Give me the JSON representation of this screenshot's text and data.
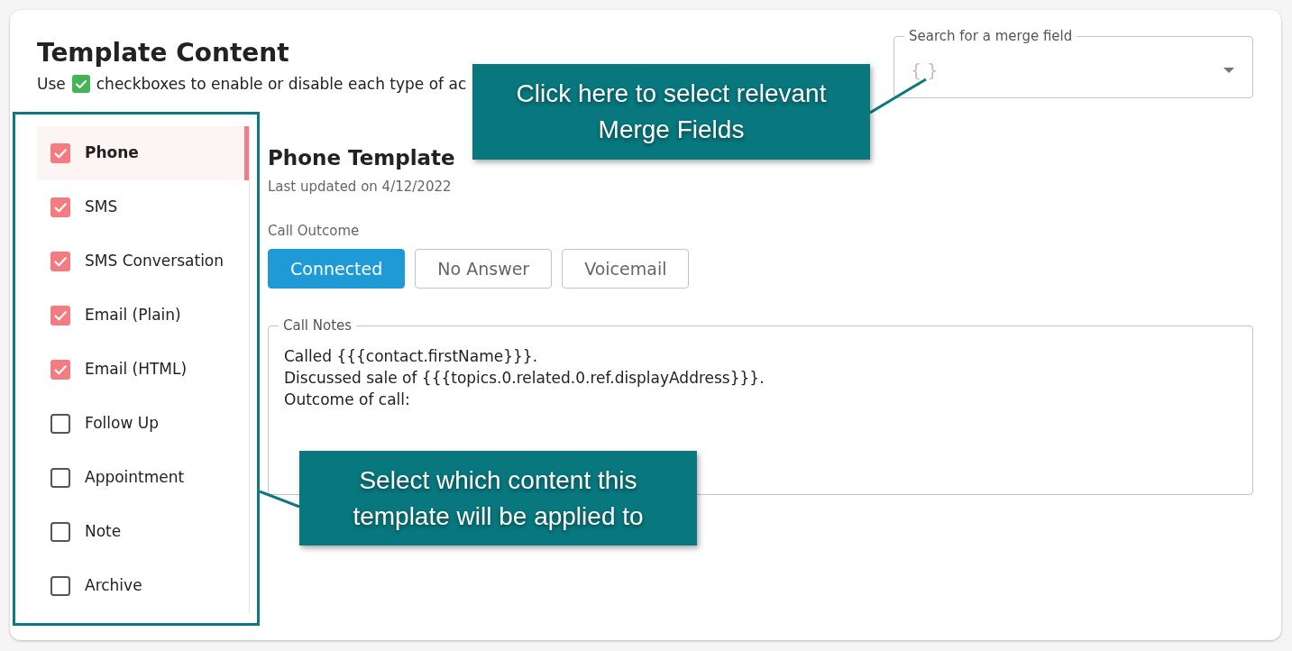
{
  "header": {
    "title": "Template Content",
    "subtitle_before_icon": "Use",
    "subtitle_after_icon": "checkboxes to enable or disable each type of ac"
  },
  "merge_field_search": {
    "label": "Search for a merge field",
    "prefix": "{ }"
  },
  "content_types": [
    {
      "label": "Phone",
      "checked": true,
      "selected": true
    },
    {
      "label": "SMS",
      "checked": true,
      "selected": false
    },
    {
      "label": "SMS Conversation",
      "checked": true,
      "selected": false
    },
    {
      "label": "Email (Plain)",
      "checked": true,
      "selected": false
    },
    {
      "label": "Email (HTML)",
      "checked": true,
      "selected": false
    },
    {
      "label": "Follow Up",
      "checked": false,
      "selected": false
    },
    {
      "label": "Appointment",
      "checked": false,
      "selected": false
    },
    {
      "label": "Note",
      "checked": false,
      "selected": false
    },
    {
      "label": "Archive",
      "checked": false,
      "selected": false
    }
  ],
  "template": {
    "title": "Phone Template",
    "updated": "Last updated on 4/12/2022"
  },
  "call_outcome": {
    "label": "Call Outcome",
    "options": [
      {
        "label": "Connected",
        "selected": true
      },
      {
        "label": "No Answer",
        "selected": false
      },
      {
        "label": "Voicemail",
        "selected": false
      }
    ]
  },
  "call_notes": {
    "label": "Call Notes",
    "value": "Called {{{contact.firstName}}}.\nDiscussed sale of {{{topics.0.related.0.ref.displayAddress}}}.\nOutcome of call:"
  },
  "callouts": [
    {
      "text": "Click here to select relevant Merge Fields"
    },
    {
      "text": "Select which content this template will be applied to"
    }
  ]
}
